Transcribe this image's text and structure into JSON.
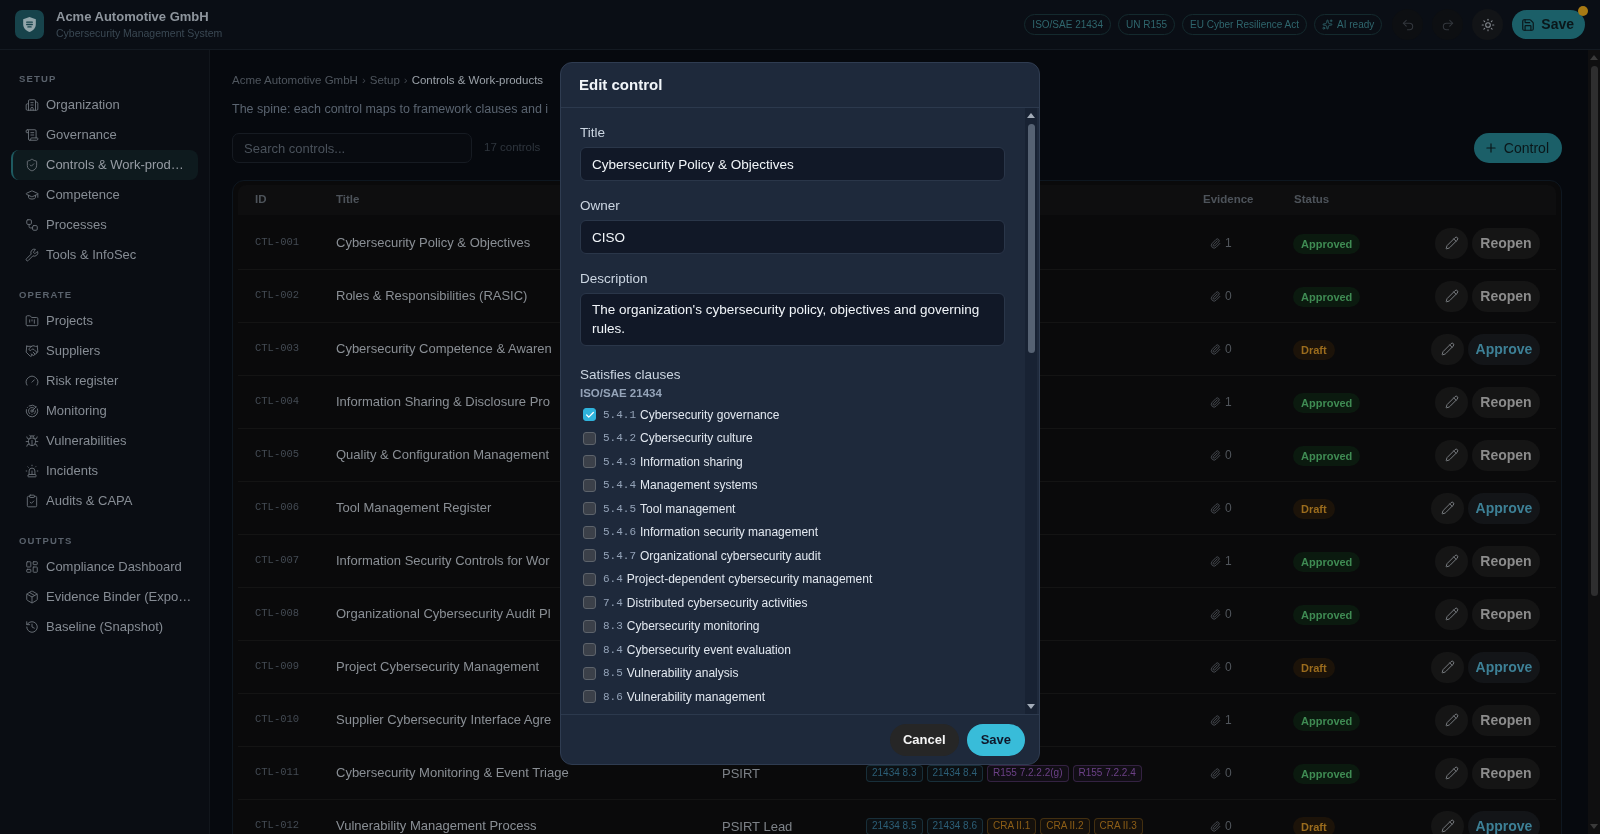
{
  "header": {
    "org_name": "Acme Automotive GmbH",
    "subtitle": "Cybersecurity Management System",
    "badges": [
      {
        "label": "ISO/SAE 21434",
        "kind": "framework"
      },
      {
        "label": "UN R155",
        "kind": "framework"
      },
      {
        "label": "EU Cyber Resilience Act",
        "kind": "framework"
      },
      {
        "label": "AI ready",
        "kind": "ai"
      }
    ],
    "icon_buttons": [
      {
        "kind": "undo",
        "disabled": true
      },
      {
        "kind": "redo",
        "disabled": true
      },
      {
        "kind": "theme",
        "disabled": false
      }
    ],
    "save_button": {
      "label": "Save",
      "unsaved": true
    }
  },
  "sidebar": {
    "sections": [
      {
        "title": "SETUP",
        "items": [
          {
            "label": "Organization",
            "selected": false
          },
          {
            "label": "Governance",
            "selected": false
          },
          {
            "label": "Controls & Work-prod…",
            "selected": true
          },
          {
            "label": "Competence",
            "selected": false
          },
          {
            "label": "Processes",
            "selected": false
          },
          {
            "label": "Tools & InfoSec",
            "selected": false
          }
        ]
      },
      {
        "title": "OPERATE",
        "items": [
          {
            "label": "Projects",
            "selected": false
          },
          {
            "label": "Suppliers",
            "selected": false
          },
          {
            "label": "Risk register",
            "selected": false
          },
          {
            "label": "Monitoring",
            "selected": false
          },
          {
            "label": "Vulnerabilities",
            "selected": false
          },
          {
            "label": "Incidents",
            "selected": false
          },
          {
            "label": "Audits & CAPA",
            "selected": false
          }
        ]
      },
      {
        "title": "OUTPUTS",
        "items": [
          {
            "label": "Compliance Dashboard",
            "selected": false
          },
          {
            "label": "Evidence Binder (Expo…",
            "selected": false
          },
          {
            "label": "Baseline (Snapshot)",
            "selected": false
          }
        ]
      }
    ]
  },
  "main": {
    "breadcrumb": {
      "items": [
        {
          "label": "Acme Automotive GmbH",
          "current": false
        },
        {
          "label": "Setup",
          "current": false
        },
        {
          "label": "Controls & Work-products",
          "current": true
        }
      ],
      "separators": [
        "›",
        "›"
      ]
    },
    "description": "The spine: each control maps to framework clauses and i",
    "search": {
      "placeholder": "Search controls..."
    },
    "count": "17 controls",
    "add_button": {
      "label": "Control"
    },
    "table": {
      "columns": {
        "id": "ID",
        "title": "Title",
        "evidence": "Evidence",
        "status": "Status"
      },
      "rows": [
        {
          "id": "CTL-001",
          "title": "Cybersecurity Policy & Objectives",
          "evidence": "1",
          "status": {
            "label": "Approved",
            "kind": "approved"
          },
          "action": {
            "label": "Reopen",
            "kind": "reopen"
          }
        },
        {
          "id": "CTL-002",
          "title": "Roles & Responsibilities (RASIC)",
          "evidence": "0",
          "status": {
            "label": "Approved",
            "kind": "approved"
          },
          "action": {
            "label": "Reopen",
            "kind": "reopen"
          }
        },
        {
          "id": "CTL-003",
          "title": "Cybersecurity Competence & Awaren",
          "evidence": "0",
          "status": {
            "label": "Draft",
            "kind": "draft"
          },
          "action": {
            "label": "Approve",
            "kind": "approve"
          }
        },
        {
          "id": "CTL-004",
          "title": "Information Sharing & Disclosure Pro",
          "evidence": "1",
          "status": {
            "label": "Approved",
            "kind": "approved"
          },
          "action": {
            "label": "Reopen",
            "kind": "reopen"
          }
        },
        {
          "id": "CTL-005",
          "title": "Quality & Configuration Management",
          "evidence": "0",
          "status": {
            "label": "Approved",
            "kind": "approved"
          },
          "action": {
            "label": "Reopen",
            "kind": "reopen"
          }
        },
        {
          "id": "CTL-006",
          "title": "Tool Management Register",
          "evidence": "0",
          "status": {
            "label": "Draft",
            "kind": "draft"
          },
          "action": {
            "label": "Approve",
            "kind": "approve"
          }
        },
        {
          "id": "CTL-007",
          "title": "Information Security Controls for Wor",
          "evidence": "1",
          "status": {
            "label": "Approved",
            "kind": "approved"
          },
          "action": {
            "label": "Reopen",
            "kind": "reopen"
          }
        },
        {
          "id": "CTL-008",
          "title": "Organizational Cybersecurity Audit Pl",
          "evidence": "0",
          "status": {
            "label": "Approved",
            "kind": "approved"
          },
          "action": {
            "label": "Reopen",
            "kind": "reopen"
          }
        },
        {
          "id": "CTL-009",
          "title": "Project Cybersecurity Management",
          "evidence": "0",
          "status": {
            "label": "Draft",
            "kind": "draft"
          },
          "action": {
            "label": "Approve",
            "kind": "approve"
          }
        },
        {
          "id": "CTL-010",
          "title": "Supplier Cybersecurity Interface Agre",
          "evidence": "1",
          "status": {
            "label": "Approved",
            "kind": "approved"
          },
          "action": {
            "label": "Reopen",
            "kind": "reopen"
          }
        },
        {
          "id": "CTL-011",
          "title": "Cybersecurity Monitoring & Event Triage",
          "owner": "PSIRT",
          "tags": [
            {
              "label": "21434 8.3",
              "color": "#2c5e76"
            },
            {
              "label": "21434 8.4",
              "color": "#2c5e76"
            },
            {
              "label": "R155 7.2.2.2(g)",
              "color": "#6c4187"
            },
            {
              "label": "R155 7.2.2.4",
              "color": "#6c4187"
            }
          ],
          "evidence": "0",
          "status": {
            "label": "Approved",
            "kind": "approved"
          },
          "action": {
            "label": "Reopen",
            "kind": "reopen"
          }
        },
        {
          "id": "CTL-012",
          "title": "Vulnerability Management Process",
          "owner": "PSIRT Lead",
          "tags": [
            {
              "label": "21434 8.5",
              "color": "#2c5e76"
            },
            {
              "label": "21434 8.6",
              "color": "#2c5e76"
            },
            {
              "label": "CRA II.1",
              "color": "#8d5e17"
            },
            {
              "label": "CRA II.2",
              "color": "#8d5e17"
            },
            {
              "label": "CRA II.3",
              "color": "#8d5e17"
            }
          ],
          "evidence": "0",
          "status": {
            "label": "Draft",
            "kind": "draft"
          },
          "action": {
            "label": "Approve",
            "kind": "approve"
          }
        }
      ]
    }
  },
  "dialog": {
    "title": "Edit control",
    "fields": [
      {
        "label": "Title",
        "value": "Cybersecurity Policy & Objectives",
        "kind": "input"
      },
      {
        "label": "Owner",
        "value": "CISO",
        "kind": "input"
      },
      {
        "label": "Description",
        "value": "The organization's cybersecurity policy, objectives and governing rules.",
        "kind": "textarea"
      }
    ],
    "clauses": {
      "label": "Satisfies clauses",
      "groups": [
        {
          "title": "ISO/SAE 21434",
          "items": [
            {
              "code": "5.4.1",
              "label": "Cybersecurity governance",
              "checked": true
            },
            {
              "code": "5.4.2",
              "label": "Cybersecurity culture",
              "checked": false
            },
            {
              "code": "5.4.3",
              "label": "Information sharing",
              "checked": false
            },
            {
              "code": "5.4.4",
              "label": "Management systems",
              "checked": false
            },
            {
              "code": "5.4.5",
              "label": "Tool management",
              "checked": false
            },
            {
              "code": "5.4.6",
              "label": "Information security management",
              "checked": false
            },
            {
              "code": "5.4.7",
              "label": "Organizational cybersecurity audit",
              "checked": false
            },
            {
              "code": "6.4",
              "label": "Project-dependent cybersecurity management",
              "checked": false
            },
            {
              "code": "7.4",
              "label": "Distributed cybersecurity activities",
              "checked": false
            },
            {
              "code": "8.3",
              "label": "Cybersecurity monitoring",
              "checked": false
            },
            {
              "code": "8.4",
              "label": "Cybersecurity event evaluation",
              "checked": false
            },
            {
              "code": "8.5",
              "label": "Vulnerability analysis",
              "checked": false
            },
            {
              "code": "8.6",
              "label": "Vulnerability management",
              "checked": false
            }
          ]
        }
      ]
    },
    "buttons": [
      {
        "label": "Cancel",
        "kind": "secondary"
      },
      {
        "label": "Save",
        "kind": "primary"
      }
    ]
  }
}
